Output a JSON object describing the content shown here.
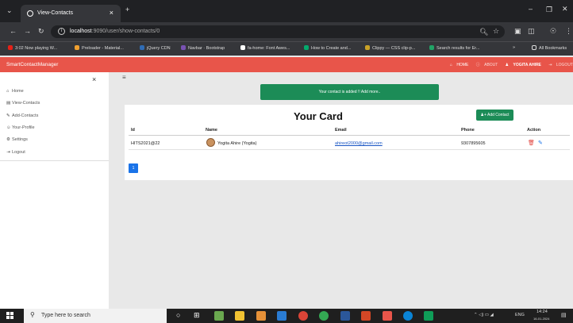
{
  "browser": {
    "tab_title": "View-Contacts",
    "tab_close": "×",
    "new_tab": "+",
    "url_host": "localhost",
    "url_path": ":9090/user/show-contacts/0",
    "bookmarks": [
      "3:02 Now playing W...",
      "Preloader - Material...",
      "jQuery CDN",
      "Navbar · Bootstrap",
      "fa-home: Font Awes...",
      "How to Create and...",
      "Clippy — CSS clip-p...",
      "Search results for Er...",
      "»",
      "All Bookmarks"
    ]
  },
  "app": {
    "brand": "SmartContactManager",
    "nav": {
      "home": "HOME",
      "about": "ABOUT",
      "user": "YOGITA AHIRE",
      "logout": "LOGOUT"
    },
    "accent": "#e8554a",
    "success": "#1c8c57"
  },
  "sidebar": {
    "close": "×",
    "items": [
      {
        "icon": "home-icon",
        "label": "Home"
      },
      {
        "icon": "id-card-icon",
        "label": "View-Contacts"
      },
      {
        "icon": "pencil-icon",
        "label": "Add-Contacts"
      },
      {
        "icon": "user-icon",
        "label": "Your-Profile"
      },
      {
        "icon": "gear-icon",
        "label": "Settings"
      },
      {
        "icon": "sign-out-icon",
        "label": "Logout"
      }
    ]
  },
  "main": {
    "menu_icon": "≡",
    "alert": "Your contact is added !! Add more..",
    "card_title": "Your Card",
    "add_button": "Add Contact",
    "columns": [
      "Id",
      "Name",
      "Email",
      "Phone",
      "Action"
    ],
    "rows": [
      {
        "id": "HITS2021@22",
        "name": "Yogita Ahire (Yogita)",
        "email": "ahireot2000@gmail.com",
        "phone": "9307895605"
      }
    ],
    "pagination": [
      "1"
    ]
  },
  "taskbar": {
    "search_placeholder": "Type here to search",
    "lang": "ENG",
    "time": "14:24",
    "date": "16-01-2024"
  }
}
